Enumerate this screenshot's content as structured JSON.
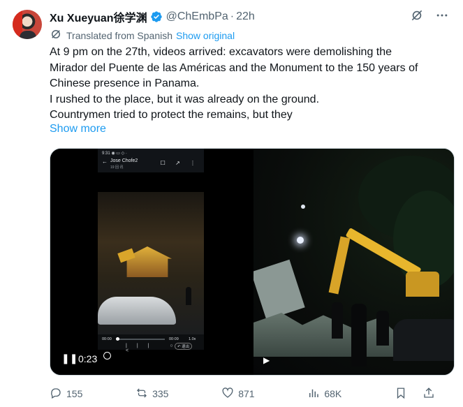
{
  "tweet": {
    "author_name": "Xu Xueyuan徐学渊",
    "handle": "@ChEmbPa",
    "separator": "·",
    "time": "22h",
    "translated_label": "Translated from Spanish",
    "show_original": "Show original",
    "text_lines": [
      "At 9 pm on the 27th, videos arrived: excavators were demolishing the",
      "Mirador del Puente de las Américas and the Monument to the 150 years of",
      "Chinese presence in Panama.",
      "I rushed to the place, but it was already on the ground.",
      "Countrymen tried to protect the remains, but they"
    ],
    "show_more": "Show more"
  },
  "media": {
    "left_video": {
      "phone_status": "9:31 ◉ ▭ ◇ ·",
      "phone_title": "Jose Chofe2",
      "phone_subtitle": "19 回 讯",
      "phone_icons": "☐ ↗ ⋮",
      "elapsed": "00:00",
      "end_time": "00:09",
      "speed": "1.0x",
      "nav_icons": "||| ○ <",
      "exit_button": "↶ 退出",
      "duration": "0:23"
    }
  },
  "actions": {
    "replies": "155",
    "reposts": "335",
    "likes": "871",
    "views": "68K"
  },
  "colors": {
    "accent": "#1d9bf0",
    "secondary_text": "#536471",
    "primary_text": "#0f1419"
  }
}
